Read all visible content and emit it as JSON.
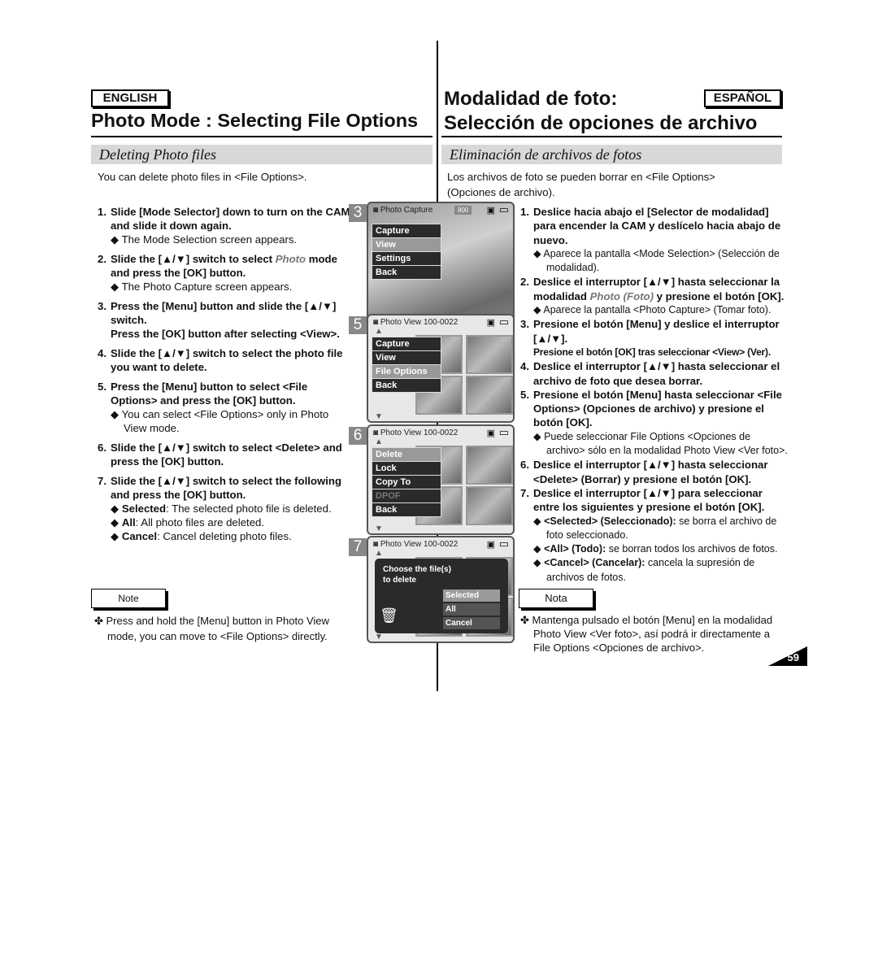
{
  "header": {
    "english_badge": "ENGLISH",
    "espanol_badge": "ESPAÑOL",
    "title_en": "Photo Mode : Selecting File Options",
    "title_es_1": "Modalidad de foto:",
    "title_es_2": "Selección de opciones de archivo"
  },
  "section": {
    "en": "Deleting Photo files",
    "es": "Eliminación de archivos de fotos"
  },
  "intro": {
    "en": "You can delete photo files in <File Options>.",
    "es": "Los archivos de foto se pueden borrar en <File Options> (Opciones de archivo)."
  },
  "steps_en": [
    {
      "num": "1.",
      "main": [
        {
          "t": "Slide [Mode Selector] down to turn on the CAM and slide it down again."
        }
      ],
      "notes": [
        [
          {
            "t": "◆ The Mode Selection screen appears."
          }
        ]
      ]
    },
    {
      "num": "2.",
      "main": [
        {
          "t": "Slide the [▲/▼] switch to select "
        },
        {
          "t": "Photo",
          "s": "it"
        },
        {
          "t": " mode and press the [OK] button."
        }
      ],
      "notes": [
        [
          {
            "t": "◆ The Photo Capture screen appears."
          }
        ]
      ]
    },
    {
      "num": "3.",
      "main": [
        {
          "t": "Press the [Menu] button and slide the [▲/▼] switch."
        },
        {
          "t": "Press the [OK] button after selecting <View>.",
          "s": "br"
        }
      ],
      "notes": []
    },
    {
      "num": "4.",
      "main": [
        {
          "t": "Slide the [▲/▼] switch to select the photo file you want to delete."
        }
      ],
      "notes": []
    },
    {
      "num": "5.",
      "main": [
        {
          "t": "Press the [Menu] button to select <File Options> and press the [OK] button."
        }
      ],
      "notes": [
        [
          {
            "t": "◆ You can select <File Options> only in Photo View mode."
          }
        ]
      ]
    },
    {
      "num": "6.",
      "main": [
        {
          "t": "Slide the [▲/▼] switch to select <Delete> and press the [OK] button."
        }
      ],
      "notes": []
    },
    {
      "num": "7.",
      "main": [
        {
          "t": "Slide the [▲/▼] switch to select the following and press the [OK] button."
        }
      ],
      "notes": [
        [
          {
            "t": "◆ "
          },
          {
            "t": "Selected",
            "s": "nb"
          },
          {
            "t": ": The selected photo file is deleted."
          }
        ],
        [
          {
            "t": "◆ "
          },
          {
            "t": "All",
            "s": "nb"
          },
          {
            "t": ": All photo files are deleted."
          }
        ],
        [
          {
            "t": "◆ "
          },
          {
            "t": "Cancel",
            "s": "nb"
          },
          {
            "t": ": Cancel deleting photo files."
          }
        ]
      ]
    }
  ],
  "steps_es": [
    {
      "num": "1.",
      "main": [
        {
          "t": "Deslice hacia abajo el [Selector de modalidad] para encender la CAM y deslícelo hacia abajo de nuevo."
        }
      ],
      "notes": [
        [
          {
            "t": "◆ Aparece la pantalla <Mode Selection> (Selección de modalidad)."
          }
        ]
      ]
    },
    {
      "num": "2.",
      "main": [
        {
          "t": "Deslice el interruptor [▲/▼] hasta seleccionar la modalidad "
        },
        {
          "t": "Photo (Foto)",
          "s": "it"
        },
        {
          "t": " y presione el botón [OK]."
        }
      ],
      "notes": [
        [
          {
            "t": "◆ Aparece la pantalla <Photo Capture> (Tomar foto)."
          }
        ]
      ]
    },
    {
      "num": "3.",
      "main": [
        {
          "t": "Presione el botón [Menu] y deslice el interruptor [▲/▼]."
        },
        {
          "t": "Presione el botón [OK] tras seleccionar <View> (Ver).",
          "s": "brsm"
        }
      ],
      "notes": []
    },
    {
      "num": "4.",
      "main": [
        {
          "t": "Deslice el interruptor [▲/▼] hasta seleccionar el archivo de foto que desea borrar."
        }
      ],
      "notes": []
    },
    {
      "num": "5.",
      "main": [
        {
          "t": "Presione el botón [Menu] hasta seleccionar <File Options> (Opciones de archivo) y presione el botón [OK]."
        }
      ],
      "notes": [
        [
          {
            "t": "◆ Puede seleccionar File Options <Opciones de archivo> sólo en la modalidad Photo View <Ver foto>."
          }
        ]
      ]
    },
    {
      "num": "6.",
      "main": [
        {
          "t": "Deslice el interruptor [▲/▼] hasta seleccionar <Delete> (Borrar) y presione el botón [OK]."
        }
      ],
      "notes": []
    },
    {
      "num": "7.",
      "main": [
        {
          "t": "Deslice el interruptor [▲/▼] para seleccionar entre los siguientes y presione el botón [OK]."
        }
      ],
      "notes": [
        [
          {
            "t": "◆ "
          },
          {
            "t": "<Selected> (Seleccionado):",
            "s": "nb"
          },
          {
            "t": " se borra el archivo de foto seleccionado."
          }
        ],
        [
          {
            "t": "◆ "
          },
          {
            "t": "<All> (Todo):",
            "s": "nb"
          },
          {
            "t": " se borran todos los archivos de fotos."
          }
        ],
        [
          {
            "t": "◆ "
          },
          {
            "t": "<Cancel> (Cancelar):",
            "s": "nb"
          },
          {
            "t": " cancela la supresión de archivos de fotos."
          }
        ]
      ]
    }
  ],
  "note": {
    "label_en": "Note",
    "label_es": "Nota",
    "text_en": "✤ Press and hold the [Menu] button in Photo View mode, you can move to <File Options> directly.",
    "text_es": "✤ Mantenga pulsado el botón [Menu] en la modalidad Photo View <Ver foto>, así podrá ir directamente a File Options <Opciones de archivo>."
  },
  "screens": [
    {
      "num": "3",
      "header": "Photo Capture",
      "extra": "800",
      "menu": [
        {
          "l": "Capture"
        },
        {
          "l": "View",
          "sel": true
        },
        {
          "l": "Settings"
        },
        {
          "l": "Back"
        }
      ]
    },
    {
      "num": "5",
      "header": "Photo View  100-0022",
      "menu": [
        {
          "l": "Capture"
        },
        {
          "l": "View"
        },
        {
          "l": "File Options",
          "sel": true
        },
        {
          "l": "Back"
        }
      ]
    },
    {
      "num": "6",
      "header": "Photo View  100-0022",
      "menu": [
        {
          "l": "Delete",
          "sel": true
        },
        {
          "l": "Lock"
        },
        {
          "l": "Copy To"
        },
        {
          "l": "DPOF",
          "dim": true
        },
        {
          "l": "Back"
        }
      ]
    },
    {
      "num": "7",
      "header": "Photo View  100-0022",
      "dialog": {
        "prompt_1": "Choose the file(s)",
        "prompt_2": "to delete",
        "options": [
          "Selected",
          "All",
          "Cancel"
        ]
      }
    }
  ],
  "icons": {
    "camera": "camera-icon",
    "battery": "battery-icon",
    "card": "memory-card-icon",
    "trash": "trash-icon"
  },
  "page_number": "59"
}
